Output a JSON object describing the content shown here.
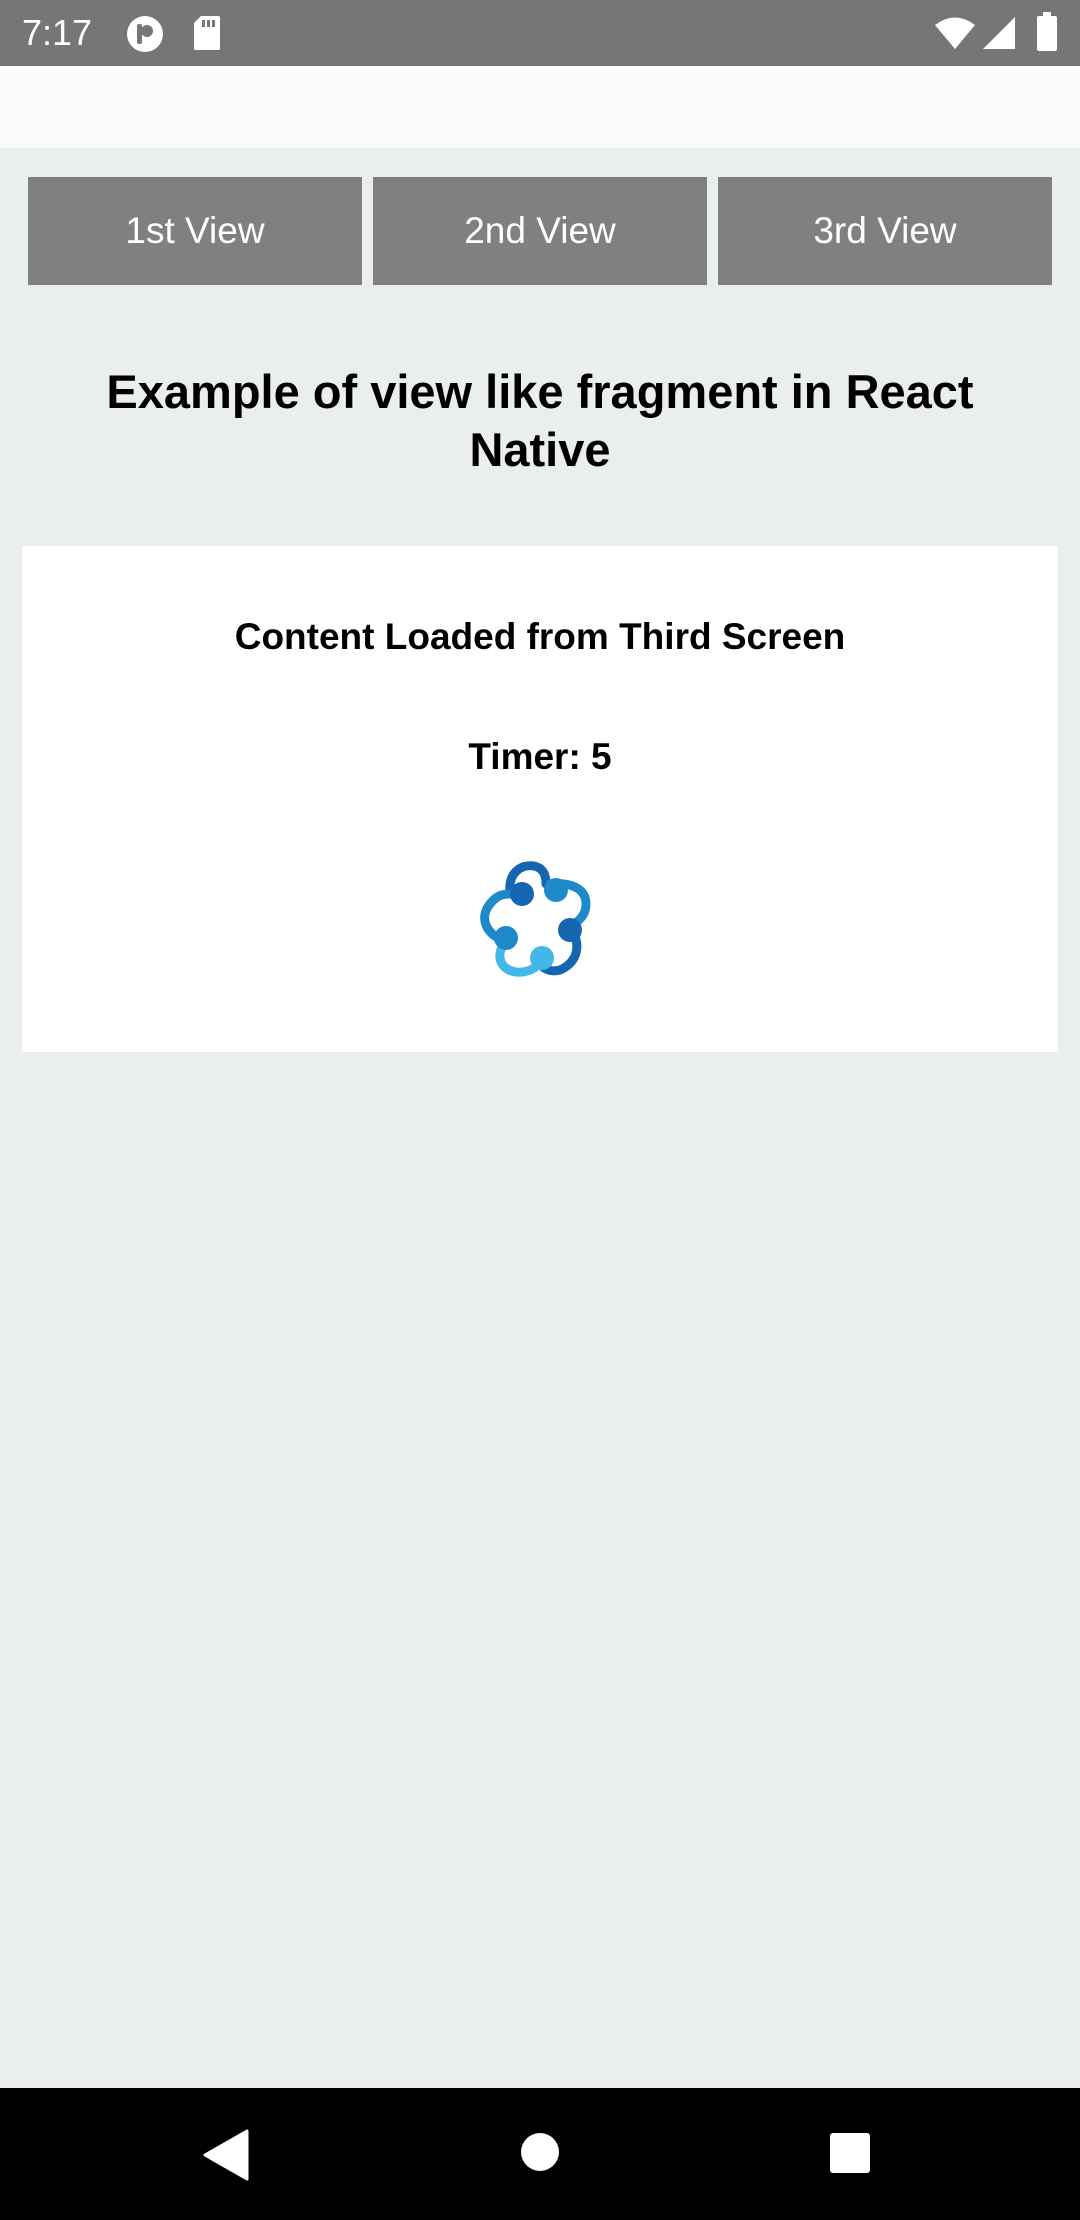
{
  "status_bar": {
    "time": "7:17",
    "left_icons": [
      "app-notification-icon",
      "sd-card-icon"
    ],
    "right_icons": [
      "wifi-icon",
      "cell-signal-icon",
      "battery-icon"
    ]
  },
  "tabs": [
    {
      "label": "1st View"
    },
    {
      "label": "2nd View"
    },
    {
      "label": "3rd View"
    }
  ],
  "heading": "Example of view like fragment in React Native",
  "card": {
    "title": "Content Loaded from Third Screen",
    "timer": "Timer: 5",
    "icon": "react-logo-icon"
  },
  "nav_bar": {
    "icons": [
      "back-icon",
      "home-icon",
      "recents-icon"
    ]
  },
  "colors": {
    "status_bar": "#767676",
    "app_bar": "#FAFAFA",
    "background": "#EBEEEF",
    "tab_button": "#808080",
    "card": "#FFFFFF",
    "nav_bar": "#000000",
    "logo_dark": "#1565B0",
    "logo_mid": "#1E8ACB",
    "logo_light": "#42B7EA"
  }
}
